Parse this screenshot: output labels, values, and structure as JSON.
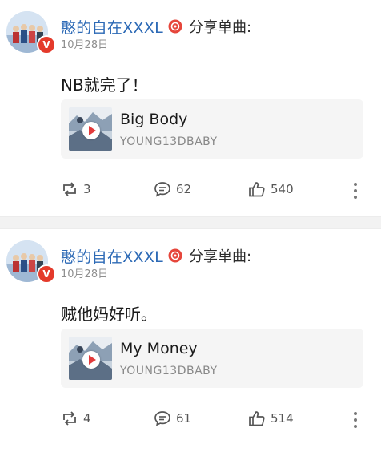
{
  "posts": [
    {
      "username": "憨的自在XXXL",
      "share_label": "分享单曲:",
      "date": "10月28日",
      "content": "NB就完了！",
      "song": {
        "title": "Big Body",
        "artist": "YOUNG13DBABY"
      },
      "reposts": "3",
      "comments": "62",
      "likes": "540"
    },
    {
      "username": "憨的自在XXXL",
      "share_label": "分享单曲:",
      "date": "10月28日",
      "content": "贼他妈好听。",
      "song": {
        "title": "My Money",
        "artist": "YOUNG13DBABY"
      },
      "reposts": "4",
      "comments": "61",
      "likes": "514"
    }
  ],
  "verified_badge": "V",
  "icons": [
    "repost-icon",
    "comment-icon",
    "like-icon",
    "more-icon",
    "play-icon",
    "brand-icon"
  ],
  "colors": {
    "username": "#2d6ab6",
    "badge": "#e43a2b",
    "card_bg": "#f5f5f5"
  }
}
